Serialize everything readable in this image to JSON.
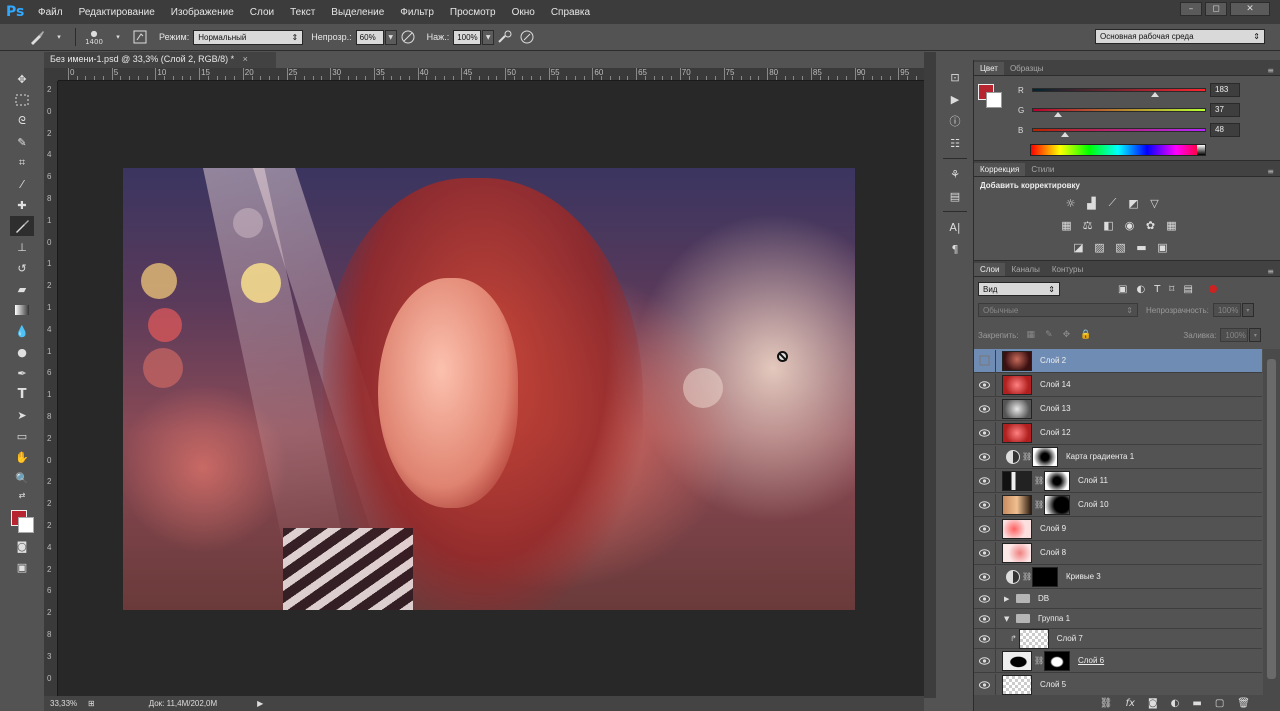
{
  "app": {
    "logo": "Ps",
    "menu": [
      "Файл",
      "Редактирование",
      "Изображение",
      "Слои",
      "Текст",
      "Выделение",
      "Фильтр",
      "Просмотр",
      "Окно",
      "Справка"
    ],
    "window_controls": [
      "–",
      "◻",
      "✕"
    ]
  },
  "options_bar": {
    "brush_size": "1400",
    "mode_label": "Режим:",
    "mode_value": "Нормальный",
    "opacity_label": "Непрозр.:",
    "opacity_value": "60%",
    "flow_label": "Наж.:",
    "flow_value": "100%",
    "workspace": "Основная рабочая среда"
  },
  "document": {
    "tab_title": "Без имени-1.psd @ 33,3% (Слой 2, RGB/8) *",
    "tab_close": "×",
    "ruler_top": [
      "0",
      "5",
      "10",
      "15",
      "20",
      "25",
      "30",
      "35",
      "40",
      "45",
      "50",
      "55",
      "60",
      "65",
      "70",
      "75",
      "80",
      "85",
      "90",
      "95",
      "100",
      "105"
    ],
    "ruler_left": [
      "2",
      "0",
      "2",
      "4",
      "6",
      "8",
      "1",
      "0",
      "1",
      "2",
      "1",
      "4",
      "1",
      "6",
      "1",
      "8",
      "2",
      "0",
      "2",
      "2",
      "2",
      "4",
      "2",
      "6",
      "2",
      "8",
      "3",
      "0"
    ]
  },
  "statusbar": {
    "zoom": "33,33%",
    "doc_info": "Док: 11,4M/202,0M"
  },
  "color_panel": {
    "tabs": [
      "Цвет",
      "Образцы"
    ],
    "fg_color": "#b72530",
    "r_label": "R",
    "r_value": "183",
    "g_label": "G",
    "g_value": "37",
    "b_label": "B",
    "b_value": "48"
  },
  "adjustments_panel": {
    "tabs": [
      "Коррекция",
      "Стили"
    ],
    "title": "Добавить корректировку"
  },
  "layers_panel": {
    "tabs": [
      "Слои",
      "Каналы",
      "Контуры"
    ],
    "filter_kind": "Вид",
    "blend_mode": "Обычные",
    "opacity_label": "Непрозрачность:",
    "opacity_value": "100%",
    "lock_label": "Закрепить:",
    "fill_label": "Заливка:",
    "fill_value": "100%",
    "layers": [
      {
        "name": "Слой 2",
        "visible": false,
        "selected": true,
        "thumb": "dark-red"
      },
      {
        "name": "Слой 14",
        "visible": true,
        "thumb": "red"
      },
      {
        "name": "Слой 13",
        "visible": true,
        "thumb": "gray"
      },
      {
        "name": "Слой 12",
        "visible": true,
        "thumb": "red"
      },
      {
        "name": "Карта градиента 1",
        "visible": true,
        "type": "adjustment",
        "mask": "soft"
      },
      {
        "name": "Слой 11",
        "visible": true,
        "thumb": "bw",
        "mask": "soft"
      },
      {
        "name": "Слой 10",
        "visible": true,
        "thumb": "photo",
        "mask": "dark"
      },
      {
        "name": "Слой 9",
        "visible": true,
        "thumb": "pink"
      },
      {
        "name": "Слой 8",
        "visible": true,
        "thumb": "pink-light"
      },
      {
        "name": "Кривые 3",
        "visible": true,
        "type": "adjustment",
        "mask": "black"
      },
      {
        "name": "DB",
        "visible": true,
        "type": "group",
        "open": false
      },
      {
        "name": "Группа 1",
        "visible": true,
        "type": "group",
        "open": true
      },
      {
        "name": "Слой 7",
        "visible": true,
        "thumb": "transparent",
        "clipped": true
      },
      {
        "name": "Слой 6",
        "visible": true,
        "thumb": "silhouette",
        "mask": "silhouette",
        "underlined": true
      },
      {
        "name": "Слой 5",
        "visible": true,
        "thumb": "transparent"
      }
    ]
  }
}
